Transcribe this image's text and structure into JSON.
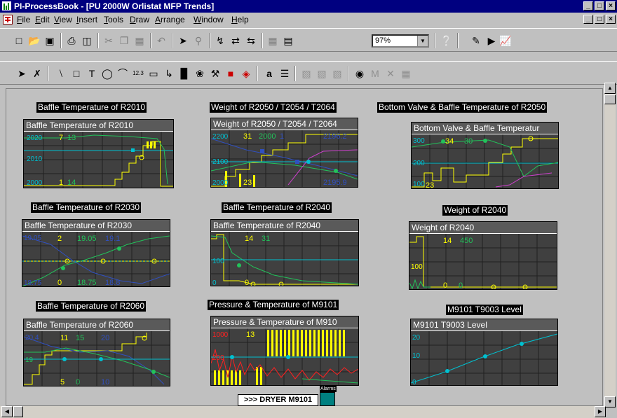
{
  "window": {
    "title": "PI-ProcessBook - [PU 2000W Orlistat MFP Trends]",
    "controls": [
      "_",
      "□",
      "×"
    ]
  },
  "menubar": {
    "items": [
      "File",
      "Edit",
      "View",
      "Insert",
      "Tools",
      "Draw",
      "Arrange",
      "Window",
      "Help"
    ]
  },
  "toolbar": {
    "zoom_value": "97%"
  },
  "drawbar": {
    "label_123": "12.3",
    "text_a": "a"
  },
  "trends": [
    {
      "caption": "Baffle Temperature of R2010",
      "header": "Baffle Temperature of R2010",
      "values": [
        "7",
        "13",
        "1",
        "14"
      ]
    },
    {
      "caption": "Weight of R2050 / T2054 / T2064",
      "header": "Weight of R2050 / T2054 / T2064",
      "values": [
        "31",
        "2000",
        "1",
        "2196.2",
        "23",
        "2195.9"
      ]
    },
    {
      "caption": "Bottom Valve & Baffle Temperature of R2050",
      "header": "Bottom Valve & Baffle Temperatur",
      "values": [
        "34",
        "30",
        "23"
      ]
    },
    {
      "caption": "Baffle Temperature of R2030",
      "header": "Baffle Temperature of R2030",
      "values": [
        "2",
        "19.05",
        "19.1",
        "0",
        "18.75",
        "18.8"
      ]
    },
    {
      "caption": "Baffle Temperature of R2040",
      "header": "Baffle Temperature of R2040",
      "values": [
        "14",
        "31",
        "0"
      ]
    },
    {
      "caption": "Weight of R2040",
      "header": "Weight of R2040",
      "values": [
        "14",
        "450",
        "0",
        "0"
      ]
    },
    {
      "caption": "Baffle Temperature of R2060",
      "header": "Baffle Temperature of R2060",
      "values": [
        "11",
        "15",
        "20",
        "5",
        "0",
        "10"
      ]
    },
    {
      "caption": "Pressure & Temperature of M9101",
      "header": "Pressure & Temperature of M910",
      "values": [
        "13"
      ]
    },
    {
      "caption": "M9101 T9003 Level",
      "header": "M9101 T9003 Level",
      "values": []
    }
  ],
  "nav": {
    "dryer_button": ">>> DRYER M9101",
    "alarms_label": "Alarms"
  },
  "colors": {
    "title_bg": "#000080",
    "trend_bg": "#404040",
    "yellow": "#ffff00",
    "green": "#22c25a",
    "cyan": "#00c0d0",
    "blue": "#3050c0",
    "red": "#ff2020",
    "magenta": "#d040d0"
  }
}
